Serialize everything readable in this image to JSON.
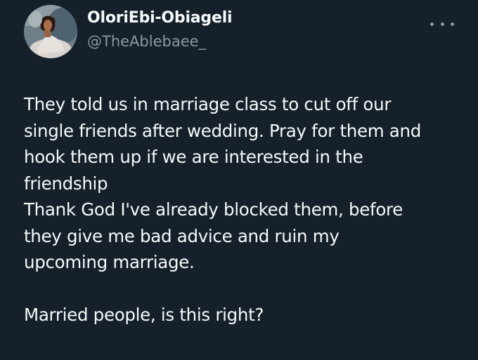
{
  "author": {
    "display_name": "OloriEbi-Obiageli",
    "handle": "@TheAblebaee_",
    "avatar_icon": "profile-photo"
  },
  "menu": {
    "icon": "more-horizontal-icon"
  },
  "tweet": {
    "lines": [
      "They told us in marriage class to cut off our",
      "single friends after wedding. Pray for them and",
      "hook them up if we are interested in the",
      "friendship",
      "Thank God I've already blocked them, before",
      "they give me bad advice and ruin my",
      "upcoming marriage.",
      "",
      "Married people, is this right?"
    ]
  },
  "colors": {
    "background": "#15202b",
    "text": "#f7f9f9",
    "secondary_text": "#8b98a5"
  }
}
